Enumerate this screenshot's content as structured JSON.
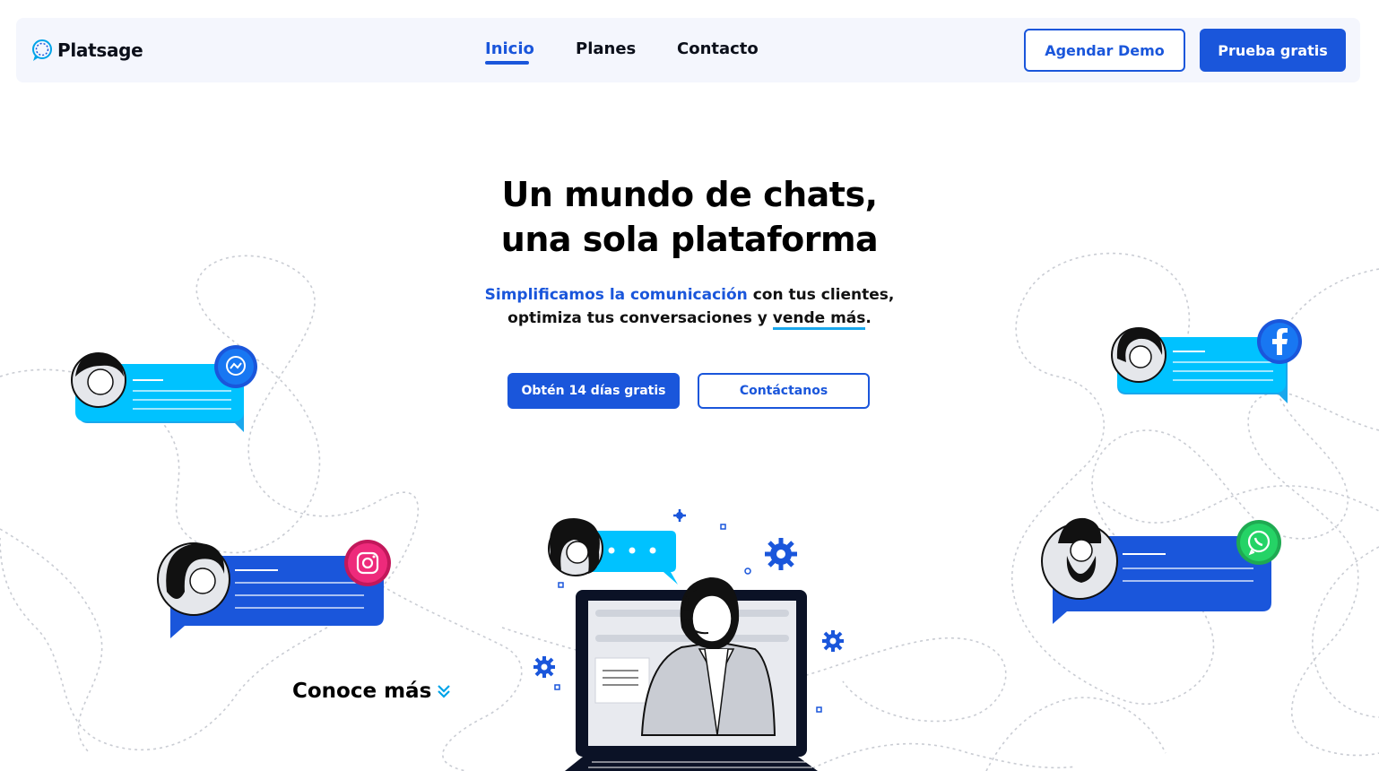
{
  "header": {
    "logo_text": "Platsage",
    "nav": [
      {
        "label": "Inicio",
        "active": true
      },
      {
        "label": "Planes",
        "active": false
      },
      {
        "label": "Contacto",
        "active": false
      }
    ],
    "demo_button": "Agendar Demo",
    "trial_button": "Prueba gratis"
  },
  "hero": {
    "title_line1": "Un mundo de chats,",
    "title_line2": "una sola plataforma",
    "subtitle_highlight": "Simplificamos la comunicación",
    "subtitle_part1": " con tus clientes,",
    "subtitle_part2": "optimiza tus conversaciones y ",
    "subtitle_underlined": "vende más",
    "subtitle_end": ".",
    "primary_cta": "Obtén 14 días gratis",
    "secondary_cta": "Contáctanos",
    "more_link": "Conoce más"
  },
  "illustration": {
    "icons": [
      "messenger-icon",
      "instagram-icon",
      "facebook-icon",
      "whatsapp-icon"
    ],
    "colors": {
      "brand_blue": "#1a56db",
      "cyan": "#00c2ff",
      "messenger": "#1877f2",
      "instagram": "#ee2a7b",
      "facebook": "#1877f2",
      "whatsapp": "#25d366"
    }
  }
}
